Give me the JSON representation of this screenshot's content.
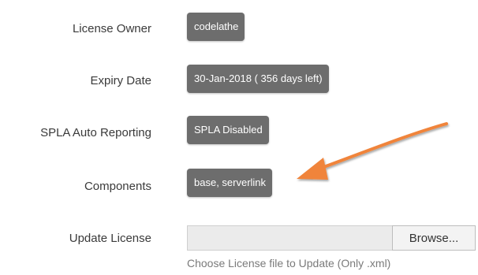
{
  "form": {
    "rows": [
      {
        "label": "License Owner",
        "value": "codelathe"
      },
      {
        "label": "Expiry Date",
        "value": "30-Jan-2018 ( 356 days left)"
      },
      {
        "label": "SPLA Auto Reporting",
        "value": "SPLA Disabled"
      },
      {
        "label": "Components",
        "value": "base, serverlink"
      }
    ],
    "update": {
      "label": "Update License",
      "file_value": "",
      "browse_label": "Browse...",
      "help_text": "Choose License file to Update (Only .xml)"
    }
  },
  "annotation": {
    "icon": "arrow-icon",
    "color": "#f0843a",
    "points_to": "Components"
  },
  "colors": {
    "badge_bg": "#6d6d6d",
    "badge_text": "#ffffff",
    "label_text": "#3a3a3a",
    "help_text": "#7a7a7a",
    "accent_arrow": "#f0843a"
  }
}
